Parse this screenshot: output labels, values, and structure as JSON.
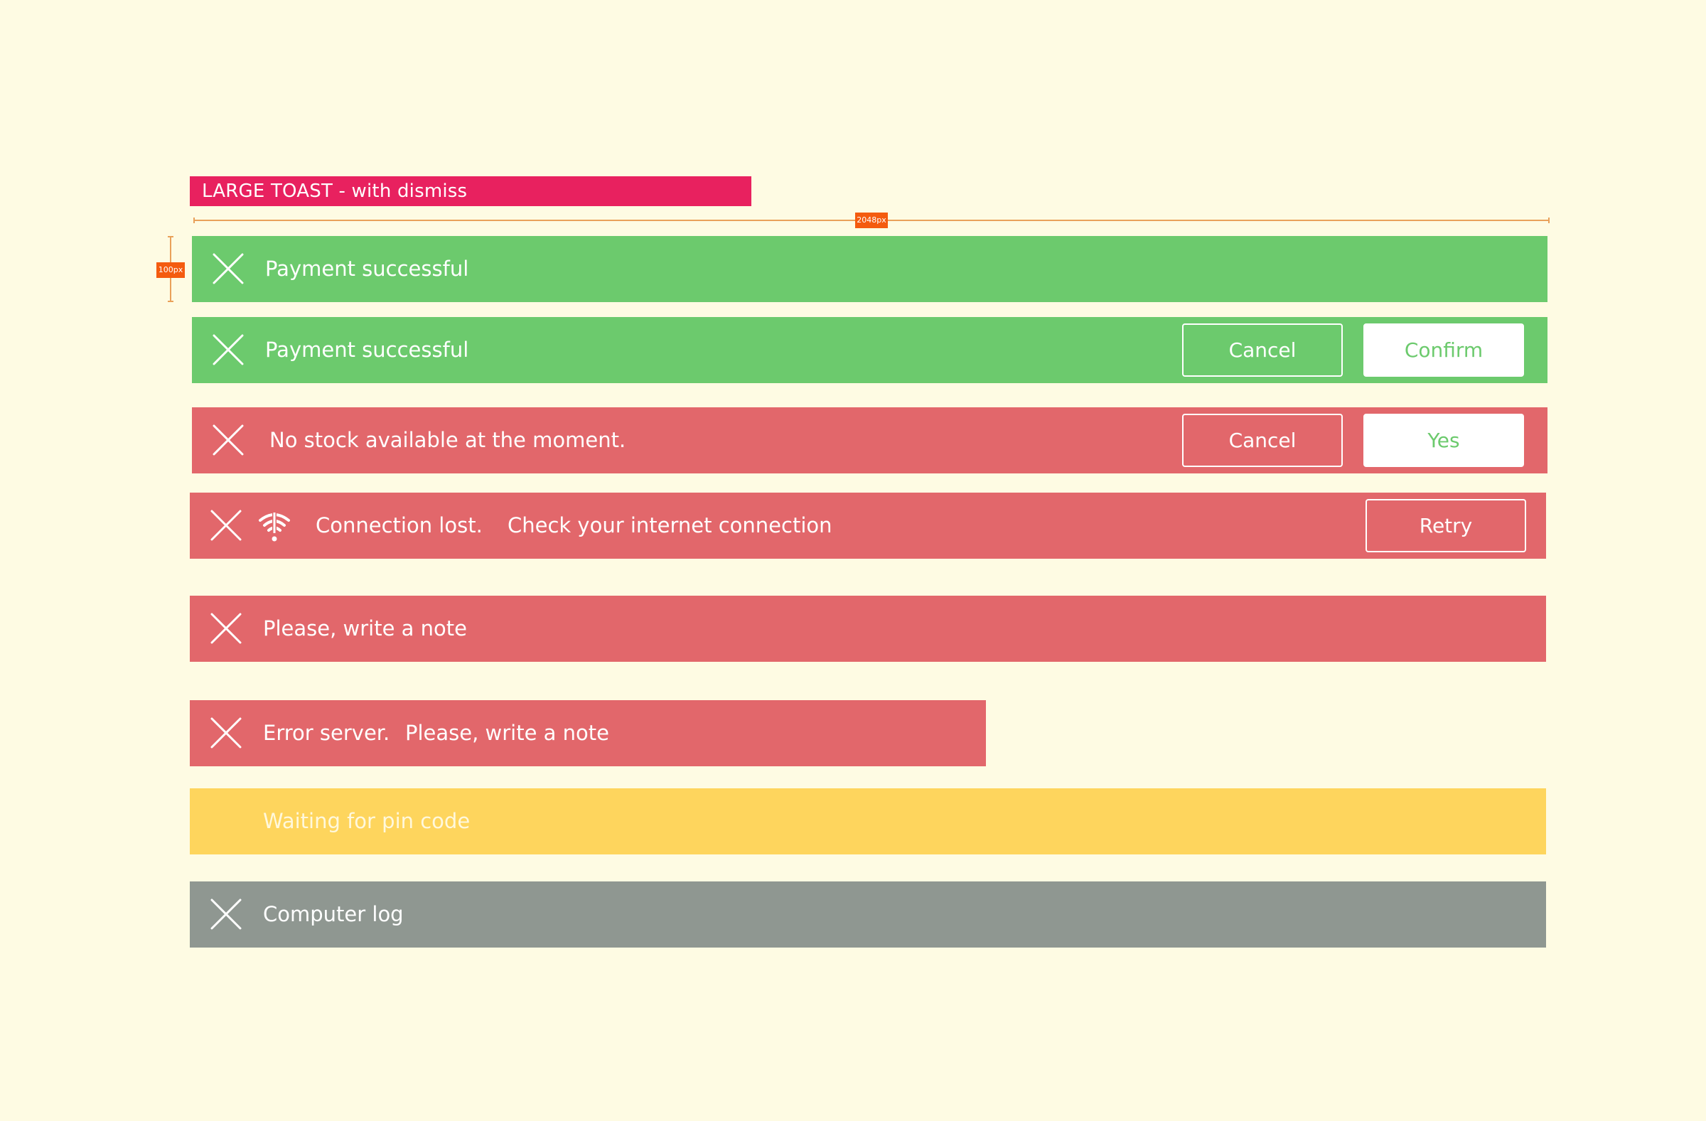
{
  "banner": {
    "title": "LARGE TOAST - with dismiss"
  },
  "measurements": {
    "width_label": "2048px",
    "height_label": "100px"
  },
  "colors": {
    "background": "#fefbe3",
    "banner": "#e8215f",
    "success": "#6cca6d",
    "error": "#e2676b",
    "warning": "#fed55d",
    "neutral": "#8f9791",
    "measure": "#f45b0f"
  },
  "toasts": [
    {
      "type": "success",
      "icon": "close-icon",
      "message": "Payment successful"
    },
    {
      "type": "success",
      "icon": "close-icon",
      "message": "Payment successful",
      "actions": [
        {
          "label": "Cancel",
          "style": "outline"
        },
        {
          "label": "Confirm",
          "style": "solid"
        }
      ]
    },
    {
      "type": "error",
      "icon": "close-icon",
      "message": "No stock available at the moment.",
      "actions": [
        {
          "label": "Cancel",
          "style": "outline"
        },
        {
          "label": "Yes",
          "style": "solid"
        }
      ]
    },
    {
      "type": "error",
      "icon": "close-icon",
      "status_icon": "wifi-alert-icon",
      "title": "Connection lost.",
      "message": "Check your internet connection",
      "actions": [
        {
          "label": "Retry",
          "style": "outline"
        }
      ]
    },
    {
      "type": "error",
      "icon": "close-icon",
      "message": "Please, write a note"
    },
    {
      "type": "error",
      "icon": "close-icon",
      "title": "Error server.",
      "message": "Please, write a note"
    },
    {
      "type": "warning",
      "message": "Waiting for pin code"
    },
    {
      "type": "neutral",
      "icon": "close-icon",
      "message": "Computer log"
    }
  ]
}
